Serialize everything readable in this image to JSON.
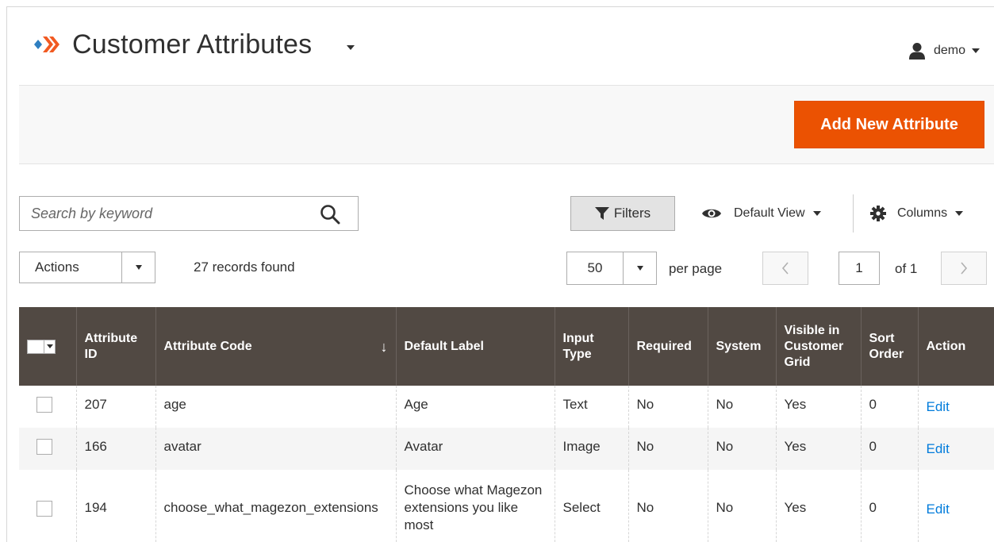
{
  "header": {
    "title": "Customer Attributes",
    "user": "demo"
  },
  "action_bar": {
    "add_button": "Add New Attribute"
  },
  "toolbar": {
    "search_placeholder": "Search by keyword",
    "filters_label": "Filters",
    "view_label": "Default View",
    "columns_label": "Columns",
    "actions_label": "Actions",
    "records_found": "27 records found",
    "per_page_value": "50",
    "per_page_label": "per page",
    "current_page": "1",
    "page_of": "of 1"
  },
  "table": {
    "columns": {
      "attribute_id": "Attribute ID",
      "attribute_code": "Attribute Code",
      "default_label": "Default Label",
      "input_type": "Input Type",
      "required": "Required",
      "system": "System",
      "visible": "Visible in Customer Grid",
      "sort_order": "Sort Order",
      "action": "Action"
    },
    "sort_indicator": "↓",
    "rows": [
      {
        "id": "207",
        "code": "age",
        "label": "Age",
        "input_type": "Text",
        "required": "No",
        "system": "No",
        "visible": "Yes",
        "sort_order": "0",
        "action": "Edit"
      },
      {
        "id": "166",
        "code": "avatar",
        "label": "Avatar",
        "input_type": "Image",
        "required": "No",
        "system": "No",
        "visible": "Yes",
        "sort_order": "0",
        "action": "Edit"
      },
      {
        "id": "194",
        "code": "choose_what_magezon_extensions",
        "label": "Choose what Magezon extensions you like most",
        "input_type": "Select",
        "required": "No",
        "system": "No",
        "visible": "Yes",
        "sort_order": "0",
        "action": "Edit"
      }
    ]
  },
  "colors": {
    "accent": "#eb5202",
    "table_header": "#514943",
    "link": "#007bdb"
  },
  "icons": [
    "magezon-logo-icon",
    "title-caret-icon",
    "user-icon",
    "search-icon",
    "filter-icon",
    "eye-icon",
    "gear-icon",
    "chevron-left-icon",
    "chevron-right-icon"
  ]
}
